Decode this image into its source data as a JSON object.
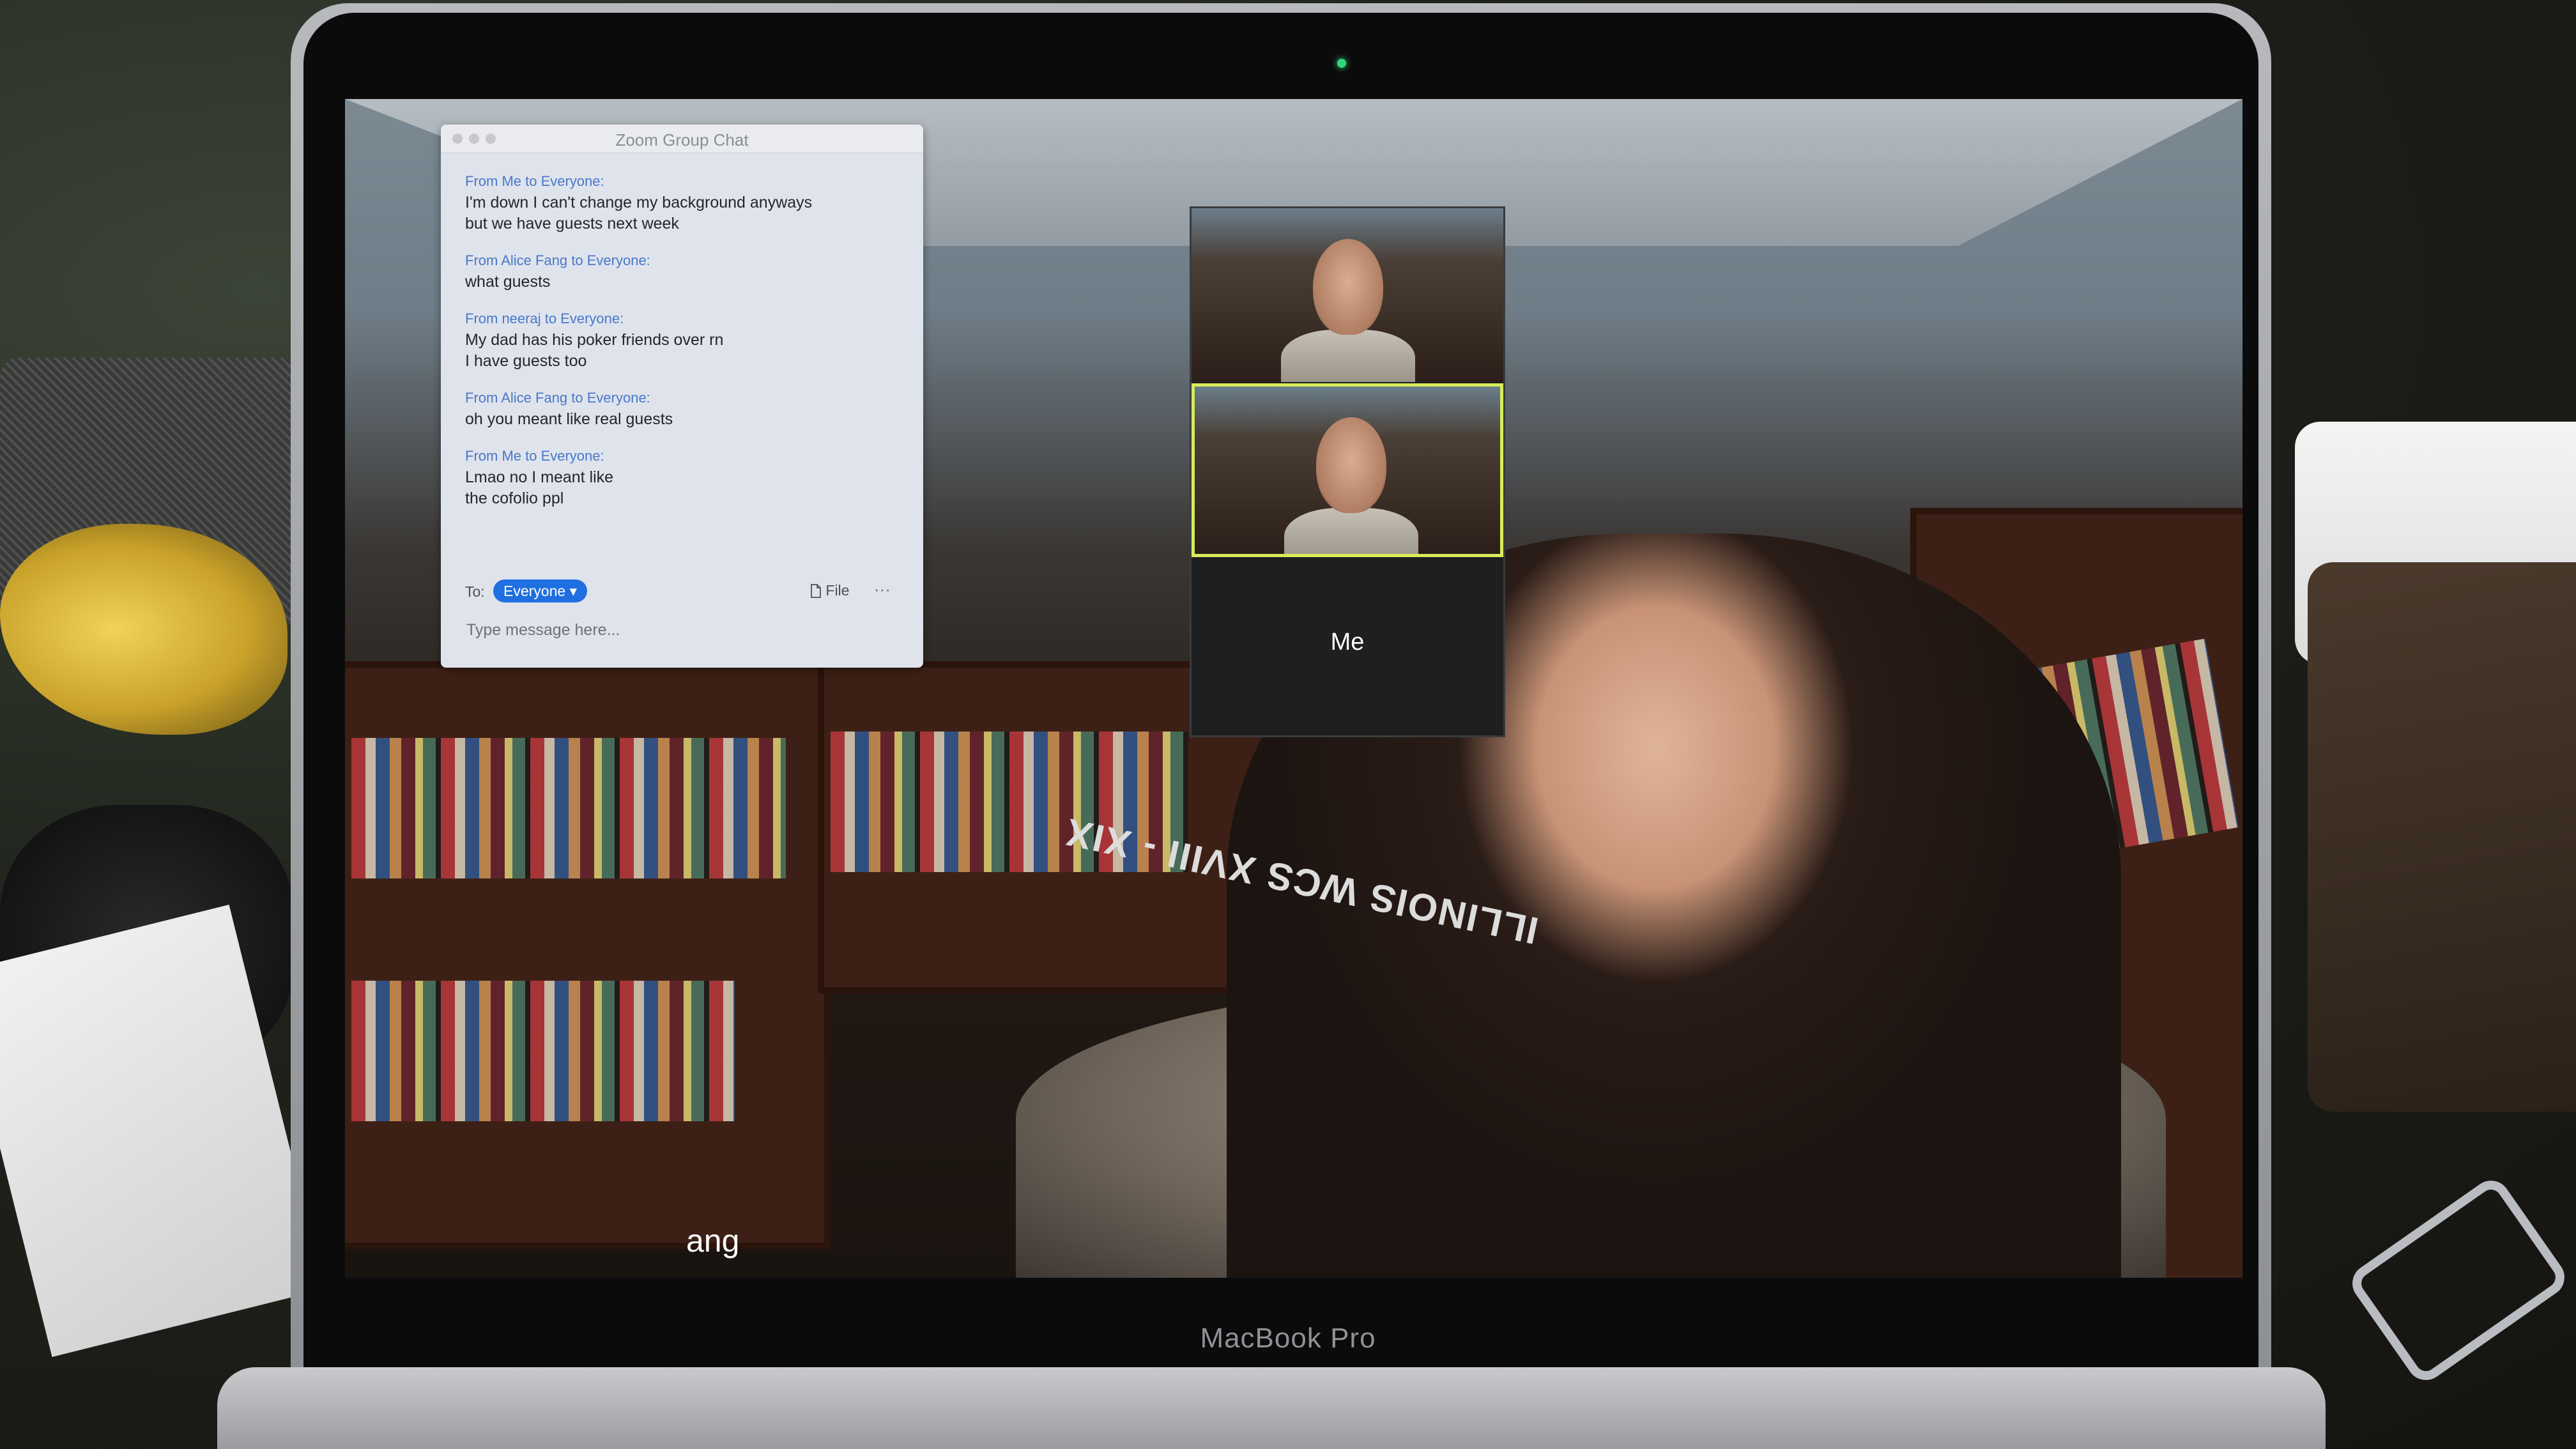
{
  "laptop": {
    "brand": "MacBook Pro"
  },
  "chat": {
    "title": "Zoom Group Chat",
    "messages": [
      {
        "from": "From Me to Everyone:",
        "lines": [
          "I'm down I can't change my background anyways",
          "but we have guests next week"
        ]
      },
      {
        "from": "From Alice Fang to Everyone:",
        "lines": [
          "what guests"
        ]
      },
      {
        "from": "From neeraj to Everyone:",
        "lines": [
          "My dad has his poker friends over rn",
          "I have guests too"
        ]
      },
      {
        "from": "From Alice Fang to Everyone:",
        "lines": [
          "oh you meant like real guests"
        ]
      },
      {
        "from": "From Me to Everyone:",
        "lines": [
          "Lmao no I meant like",
          "the cofolio ppl"
        ]
      }
    ],
    "to_label": "To:",
    "recipient": "Everyone ▾",
    "file_label": "File",
    "more_label": "···",
    "input_placeholder": "Type message here..."
  },
  "gallery": {
    "me_label": "Me"
  },
  "video": {
    "name_tag": "ang",
    "chair_text": "ILLINOIS WCS XVIII - XIX"
  },
  "icons": {
    "file": "document-icon"
  }
}
